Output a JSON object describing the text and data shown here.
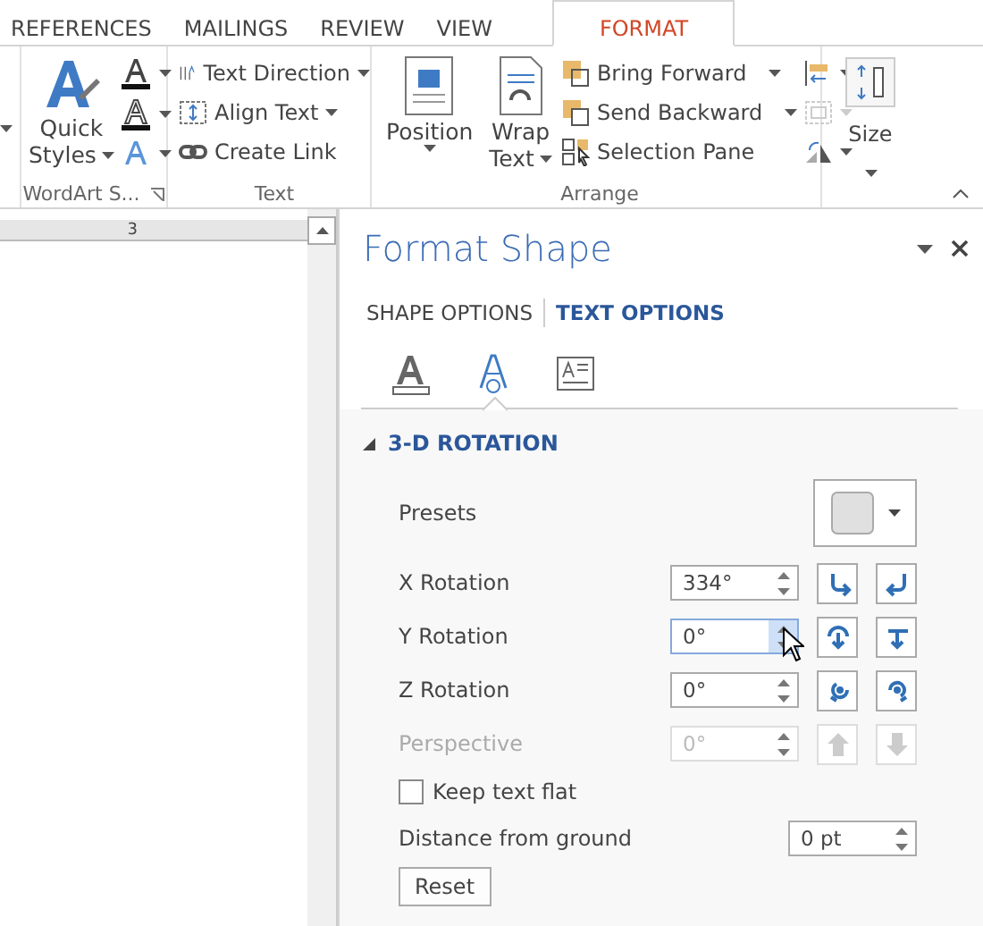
{
  "tabs": [
    {
      "label": "REFERENCES",
      "selected": false
    },
    {
      "label": "MAILINGS",
      "selected": false
    },
    {
      "label": "REVIEW",
      "selected": false
    },
    {
      "label": "VIEW",
      "selected": false
    },
    {
      "label": "FORMAT",
      "selected": true
    }
  ],
  "ribbon": {
    "wordart": {
      "quick_styles": [
        "Quick",
        "Styles"
      ],
      "group_label": "WordArt S..."
    },
    "text_group": {
      "items": [
        "Text Direction",
        "Align Text",
        "Create Link"
      ],
      "group_label": "Text"
    },
    "arrange": {
      "position": "Position",
      "wrap_text": [
        "Wrap",
        "Text"
      ],
      "items": [
        "Bring Forward",
        "Send Backward",
        "Selection Pane"
      ],
      "group_label": "Arrange"
    },
    "size": {
      "label": "Size"
    }
  },
  "ruler": {
    "mark": "3"
  },
  "panel": {
    "title": "Format Shape",
    "tabs": [
      {
        "label": "SHAPE OPTIONS",
        "selected": false
      },
      {
        "label": "TEXT OPTIONS",
        "selected": true
      }
    ],
    "icon_tabs": [
      {
        "selected": false
      },
      {
        "selected": true
      },
      {
        "selected": false
      }
    ],
    "section": {
      "title": "3-D ROTATION",
      "expanded": true
    },
    "presets_label": "Presets",
    "rows": [
      {
        "label": "X Rotation",
        "value": "334°",
        "disabled": false,
        "focused": false
      },
      {
        "label": "Y Rotation",
        "value": "0°",
        "disabled": false,
        "focused": true
      },
      {
        "label": "Z Rotation",
        "value": "0°",
        "disabled": false,
        "focused": false
      },
      {
        "label": "Perspective",
        "value": "0°",
        "disabled": true,
        "focused": false
      }
    ],
    "keep_flat": {
      "label": "Keep text flat",
      "checked": false
    },
    "distance": {
      "label": "Distance from ground",
      "value": "0 pt"
    },
    "reset": "Reset"
  }
}
